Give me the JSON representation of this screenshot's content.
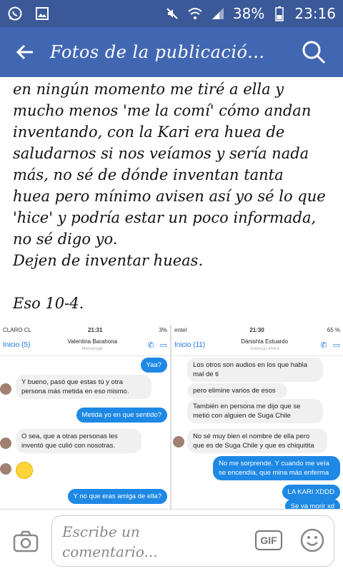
{
  "status_bar": {
    "battery_percent": "38%",
    "time": "23:16"
  },
  "app_bar": {
    "title": "Fotos de la publicació..."
  },
  "post": {
    "lines": [
      "en ningún momento me tiré a ella y",
      "mucho menos 'me la comí' cómo andan",
      "inventando, con la Kari era huea de",
      "saludarnos si nos veíamos y sería nada",
      "más, no sé de dónde inventan tanta",
      "huea pero mínimo avisen así yo sé lo que",
      "'hice' y podría estar un poco informada,",
      "no sé digo yo.",
      "Dejen de inventar hueas.",
      "",
      "Eso 10-4."
    ]
  },
  "left_chat": {
    "carrier": "CLARO CL",
    "time": "21:31",
    "battery": "3%",
    "back_label": "Inicio (5)",
    "contact_name": "Valentina Barahona",
    "contact_sub": "Messenger",
    "messages": [
      {
        "text": "Yaa?"
      },
      {
        "text": "Y bueno, pasó que estas tú y otra persona más metida en eso mismo."
      },
      {
        "text": "Metida yo en que sentido?"
      },
      {
        "text": "O sea, que a otras personas les inventó que culió con nosotras."
      },
      {
        "text": "Y no que eras amiga de ella?"
      }
    ]
  },
  "right_chat": {
    "carrier": "entel",
    "time": "21:30",
    "battery": "65 %",
    "back_label": "Inicio (11)",
    "contact_name": "Dánishta Estuardo",
    "contact_sub": "Activo(a) ahora",
    "messages": [
      {
        "text": "Los otros son audios en los que habla mal de ti"
      },
      {
        "text": "pero elimine varios de esos"
      },
      {
        "text": "También en persona me dijo que se metió con alguien de Suga Chile"
      },
      {
        "text": "No sé muy bien el nombre de ella pero que es de Suga Chile y que es chiquitita"
      },
      {
        "text": "No me sorprende. Y cuando me veía se encendía, que mina más enferma"
      },
      {
        "text": "LA KARI XDDD"
      },
      {
        "text": "Se va morir xd"
      }
    ]
  },
  "composer": {
    "placeholder": "Escribe un comentario...",
    "gif_label": "GIF"
  }
}
